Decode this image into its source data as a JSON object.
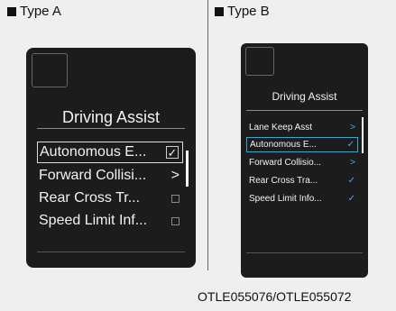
{
  "labels": {
    "type_a": "Type A",
    "type_b": "Type B"
  },
  "caption": "OTLE055076/OTLE055072",
  "display_a": {
    "title": "Driving Assist",
    "items": [
      {
        "label": "Autonomous E...",
        "indicator": "checkbox-checked-icon",
        "symbol": "✓",
        "selected": true
      },
      {
        "label": "Forward Collisi...",
        "indicator": "chevron-right-icon",
        "symbol": ">",
        "selected": false
      },
      {
        "label": "Rear Cross Tr...",
        "indicator": "checkbox-empty-icon",
        "symbol": "",
        "selected": false
      },
      {
        "label": "Speed Limit Inf...",
        "indicator": "checkbox-empty-icon",
        "symbol": "",
        "selected": false
      }
    ]
  },
  "display_b": {
    "title": "Driving Assist",
    "items": [
      {
        "label": "Lane Keep Asst",
        "indicator": "chevron-right-icon",
        "symbol": ">",
        "selected": false
      },
      {
        "label": "Autonomous E...",
        "indicator": "check-icon",
        "symbol": "✓",
        "selected": true
      },
      {
        "label": "Forward Collisio...",
        "indicator": "chevron-right-icon",
        "symbol": ">",
        "selected": false
      },
      {
        "label": "Rear Cross Tra...",
        "indicator": "check-icon",
        "symbol": "✓",
        "selected": false
      },
      {
        "label": "Speed Limit Info...",
        "indicator": "check-icon",
        "symbol": "✓",
        "selected": false
      }
    ]
  },
  "colors": {
    "background": "#efefef",
    "display": "#1c1c1c",
    "accent_b": "#3aa7c8"
  }
}
